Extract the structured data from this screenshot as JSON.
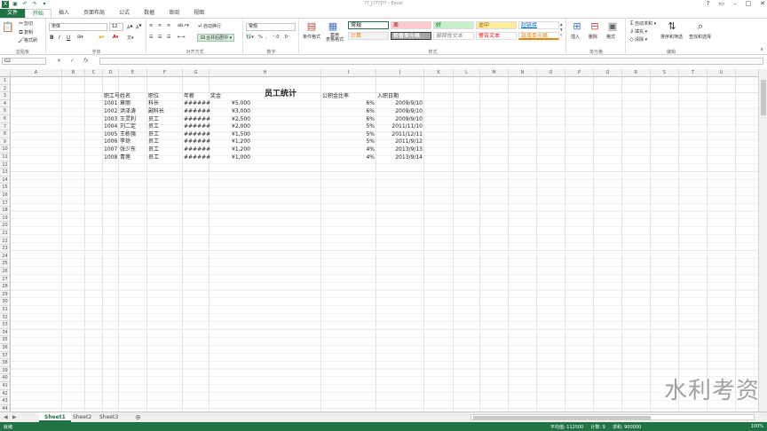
{
  "window": {
    "title": "??_[???]?? - Excel",
    "qat": [
      "save-icon",
      "undo-icon",
      "redo-icon"
    ]
  },
  "tabs": [
    "文件",
    "开始",
    "插入",
    "页面布局",
    "公式",
    "数据",
    "审阅",
    "视图"
  ],
  "ribbon": {
    "clipboard": {
      "cut": "剪切",
      "copy": "复制",
      "format_painter": "格式刷",
      "label": "剪贴板"
    },
    "font": {
      "name": "宋体",
      "size": "12",
      "bold": "B",
      "italic": "I",
      "underline": "U",
      "label": "字体"
    },
    "alignment": {
      "wrap": "自动换行",
      "merge": "合并后居中",
      "label": "对齐方式"
    },
    "number": {
      "format": "常规",
      "percent": "%",
      "comma": ",",
      "label": "数字"
    },
    "styles": {
      "conditional": "条件格式",
      "table_format": "套用\n表格格式",
      "cells": [
        {
          "text": "常规",
          "bg": "#ffffff",
          "color": "#000000"
        },
        {
          "text": "差",
          "bg": "#ffc7ce",
          "color": "#9c0006"
        },
        {
          "text": "好",
          "bg": "#c6efce",
          "color": "#006100"
        },
        {
          "text": "适中",
          "bg": "#ffeb9c",
          "color": "#9c5700"
        },
        {
          "text": "超链接",
          "bg": "#ffffff",
          "color": "#0563c1"
        },
        {
          "text": "计算",
          "bg": "#f2f2f2",
          "color": "#fa7d00"
        },
        {
          "text": "检查单元格",
          "bg": "#a5a5a5",
          "color": "#ffffff"
        },
        {
          "text": "解释性文本",
          "bg": "#ffffff",
          "color": "#7f7f7f"
        },
        {
          "text": "警告文本",
          "bg": "#ffffff",
          "color": "#ff0000"
        },
        {
          "text": "链接单元格",
          "bg": "#ffffff",
          "color": "#fa7d00"
        }
      ],
      "label": "样式"
    },
    "cells_group": {
      "insert": "插入",
      "delete": "删除",
      "format": "格式",
      "label": "单元格"
    },
    "editing": {
      "autosum": "自动求和",
      "fill": "填充",
      "clear": "清除",
      "sort": "排序和筛选",
      "find": "查找和选择",
      "label": "编辑"
    }
  },
  "formula_bar": {
    "name_box": "G2",
    "fx": "fx",
    "value": ""
  },
  "columns": [
    "A",
    "B",
    "C",
    "D",
    "E",
    "F",
    "G",
    "H",
    "I",
    "J",
    "K",
    "L",
    "M",
    "N",
    "O",
    "P",
    "Q",
    "R",
    "S",
    "T",
    "U"
  ],
  "row_count": 44,
  "sheet": {
    "title": "员工统计",
    "headers": [
      "职工号",
      "姓名",
      "职位",
      "年薪",
      "奖金",
      "公积金比率",
      "入职日期"
    ],
    "rows": [
      [
        "1001",
        "章丽",
        "科长",
        "######",
        "¥5,000",
        "6%",
        "2009/9/10"
      ],
      [
        "1002",
        "洪泽涛",
        "副科长",
        "######",
        "¥3,000",
        "6%",
        "2009/9/10"
      ],
      [
        "1003",
        "王灵利",
        "员工",
        "######",
        "¥2,500",
        "6%",
        "2009/9/10"
      ],
      [
        "1004",
        "刘二定",
        "员工",
        "######",
        "¥2,000",
        "5%",
        "2011/11/10"
      ],
      [
        "1005",
        "王栋强",
        "员工",
        "######",
        "¥1,500",
        "5%",
        "2011/12/11"
      ],
      [
        "1006",
        "李琼",
        "员工",
        "######",
        "¥1,200",
        "5%",
        "2011/9/12"
      ],
      [
        "1007",
        "张少东",
        "员工",
        "######",
        "¥1,200",
        "4%",
        "2013/9/13"
      ],
      [
        "1008",
        "青莲",
        "员工",
        "######",
        "¥1,000",
        "4%",
        "2013/9/14"
      ]
    ]
  },
  "sheet_tabs": [
    "Sheet1",
    "Sheet2",
    "Sheet3"
  ],
  "status": {
    "mode": "就绪",
    "average": "平均值: 112500",
    "count": "计数: 9",
    "sum": "求和: 900000",
    "zoom": "100%"
  },
  "watermark": "水利考资",
  "accent": "#217346"
}
